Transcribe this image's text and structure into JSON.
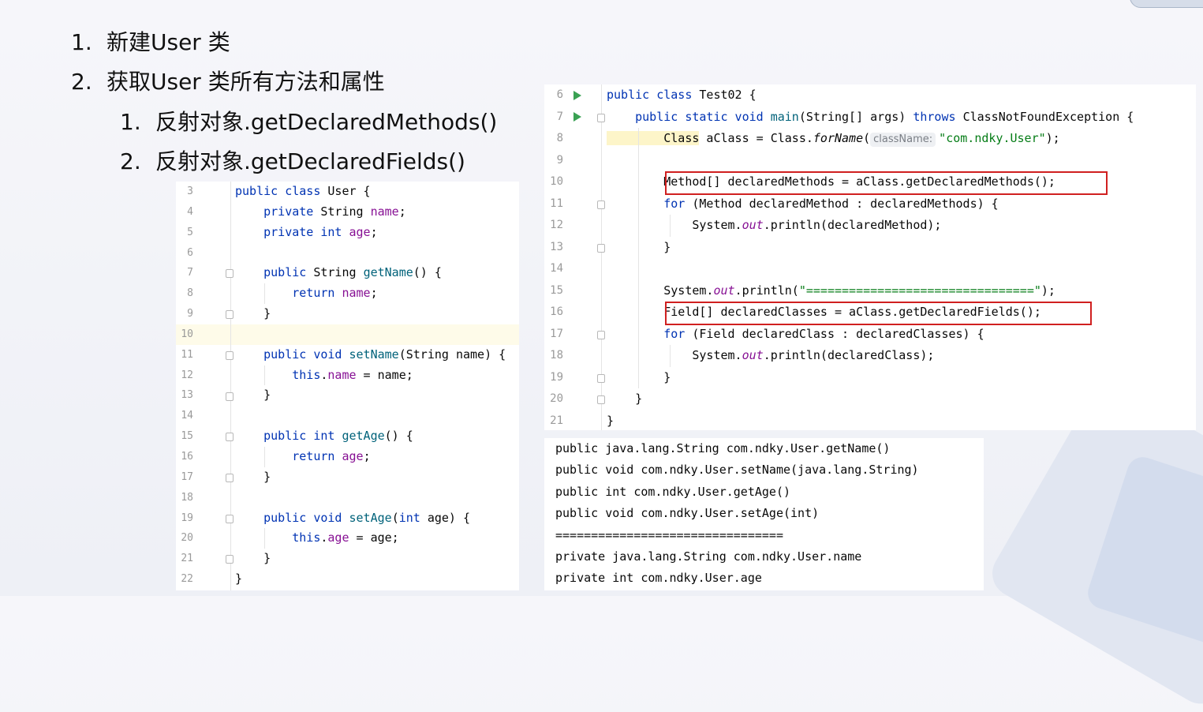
{
  "slide": {
    "bullets": [
      {
        "num": "1.",
        "text": "新建User 类"
      },
      {
        "num": "2.",
        "text": "获取User 类所有方法和属性"
      },
      {
        "num": "1.",
        "text": "反射对象.getDeclaredMethods()"
      },
      {
        "num": "2.",
        "text": "反射对象.getDeclaredFields()"
      }
    ]
  },
  "user_code": {
    "lines": [
      {
        "n": "3",
        "tokens": [
          [
            "kw",
            "public class "
          ],
          [
            "",
            "User {"
          ]
        ]
      },
      {
        "n": "4",
        "tokens": [
          [
            "kw",
            "    private "
          ],
          [
            "",
            "String "
          ],
          [
            "field",
            "name"
          ],
          [
            "",
            ";"
          ]
        ]
      },
      {
        "n": "5",
        "tokens": [
          [
            "kw",
            "    private int "
          ],
          [
            "field",
            "age"
          ],
          [
            "",
            ";"
          ]
        ]
      },
      {
        "n": "6",
        "tokens": []
      },
      {
        "n": "7",
        "tokens": [
          [
            "kw",
            "    public "
          ],
          [
            "",
            "String "
          ],
          [
            "fn",
            "getName"
          ],
          [
            "",
            "() {"
          ]
        ]
      },
      {
        "n": "8",
        "tokens": [
          [
            "kw",
            "        return "
          ],
          [
            "field",
            "name"
          ],
          [
            "",
            ";"
          ]
        ]
      },
      {
        "n": "9",
        "tokens": [
          [
            "",
            "    }"
          ]
        ]
      },
      {
        "n": "10",
        "tokens": []
      },
      {
        "n": "11",
        "tokens": [
          [
            "kw",
            "    public void "
          ],
          [
            "fn",
            "setName"
          ],
          [
            "",
            "(String name) {"
          ]
        ]
      },
      {
        "n": "12",
        "tokens": [
          [
            "kw",
            "        this"
          ],
          [
            "",
            "."
          ],
          [
            "field",
            "name"
          ],
          [
            "",
            " = name;"
          ]
        ]
      },
      {
        "n": "13",
        "tokens": [
          [
            "",
            "    }"
          ]
        ]
      },
      {
        "n": "14",
        "tokens": []
      },
      {
        "n": "15",
        "tokens": [
          [
            "kw",
            "    public int "
          ],
          [
            "fn",
            "getAge"
          ],
          [
            "",
            "() {"
          ]
        ]
      },
      {
        "n": "16",
        "tokens": [
          [
            "kw",
            "        return "
          ],
          [
            "field",
            "age"
          ],
          [
            "",
            ";"
          ]
        ]
      },
      {
        "n": "17",
        "tokens": [
          [
            "",
            "    }"
          ]
        ]
      },
      {
        "n": "18",
        "tokens": []
      },
      {
        "n": "19",
        "tokens": [
          [
            "kw",
            "    public void "
          ],
          [
            "fn",
            "setAge"
          ],
          [
            "",
            "("
          ],
          [
            "kw",
            "int"
          ],
          [
            "",
            " age) {"
          ]
        ]
      },
      {
        "n": "20",
        "tokens": [
          [
            "kw",
            "        this"
          ],
          [
            "",
            "."
          ],
          [
            "field",
            "age"
          ],
          [
            "",
            " = age;"
          ]
        ]
      },
      {
        "n": "21",
        "tokens": [
          [
            "",
            "    }"
          ]
        ]
      },
      {
        "n": "22",
        "tokens": [
          [
            "",
            "}"
          ]
        ]
      }
    ]
  },
  "test_code": {
    "lines": [
      {
        "n": "6",
        "tokens": [
          [
            "kw",
            "public class "
          ],
          [
            "",
            "Test02 {"
          ]
        ]
      },
      {
        "n": "7",
        "tokens": [
          [
            "kw",
            "    public static void "
          ],
          [
            "fn",
            "main"
          ],
          [
            "",
            "(String[] args) "
          ],
          [
            "kw",
            "throws "
          ],
          [
            "",
            "ClassNotFoundException {"
          ]
        ]
      },
      {
        "n": "8",
        "tokens": [
          [
            "hl",
            "        Class"
          ],
          [
            "",
            " aClass = Class."
          ],
          [
            "it",
            "forName"
          ],
          [
            "",
            "("
          ],
          [
            "hint",
            "className:"
          ],
          [
            "str",
            "\"com.ndky.User\""
          ],
          [
            "",
            ");"
          ]
        ]
      },
      {
        "n": "9",
        "tokens": []
      },
      {
        "n": "10",
        "tokens": [
          [
            "",
            "        Method[] declaredMethods = aClass.getDeclaredMethods();"
          ]
        ]
      },
      {
        "n": "11",
        "tokens": [
          [
            "kw",
            "        for "
          ],
          [
            "",
            "(Method declaredMethod : declaredMethods) {"
          ]
        ]
      },
      {
        "n": "12",
        "tokens": [
          [
            "",
            "            System."
          ],
          [
            "itf",
            "out"
          ],
          [
            "",
            ".println(declaredMethod);"
          ]
        ]
      },
      {
        "n": "13",
        "tokens": [
          [
            "",
            "        }"
          ]
        ]
      },
      {
        "n": "14",
        "tokens": []
      },
      {
        "n": "15",
        "tokens": [
          [
            "",
            "        System."
          ],
          [
            "itf",
            "out"
          ],
          [
            "",
            ".println("
          ],
          [
            "str",
            "\"================================\""
          ],
          [
            "",
            ");"
          ]
        ]
      },
      {
        "n": "16",
        "tokens": [
          [
            "",
            "        Field[] declaredClasses = aClass.getDeclaredFields();"
          ]
        ]
      },
      {
        "n": "17",
        "tokens": [
          [
            "kw",
            "        for "
          ],
          [
            "",
            "(Field declaredClass : declaredClasses) {"
          ]
        ]
      },
      {
        "n": "18",
        "tokens": [
          [
            "",
            "            System."
          ],
          [
            "itf",
            "out"
          ],
          [
            "",
            ".println(declaredClass);"
          ]
        ]
      },
      {
        "n": "19",
        "tokens": [
          [
            "",
            "        }"
          ]
        ]
      },
      {
        "n": "20",
        "tokens": [
          [
            "",
            "    }"
          ]
        ]
      },
      {
        "n": "21",
        "tokens": [
          [
            "",
            "}"
          ]
        ]
      }
    ]
  },
  "output": {
    "lines": [
      "public java.lang.String com.ndky.User.getName()",
      "public void com.ndky.User.setName(java.lang.String)",
      "public int com.ndky.User.getAge()",
      "public void com.ndky.User.setAge(int)",
      "================================",
      "private java.lang.String com.ndky.User.name",
      "private int com.ndky.User.age"
    ]
  },
  "colors": {
    "keyword": "#0033b3",
    "field": "#871094",
    "method": "#00627a",
    "string": "#067d17",
    "highlight_box": "#d02020",
    "run_icon": "#3aa153"
  },
  "icons": [
    "run-icon",
    "fold-icon"
  ]
}
